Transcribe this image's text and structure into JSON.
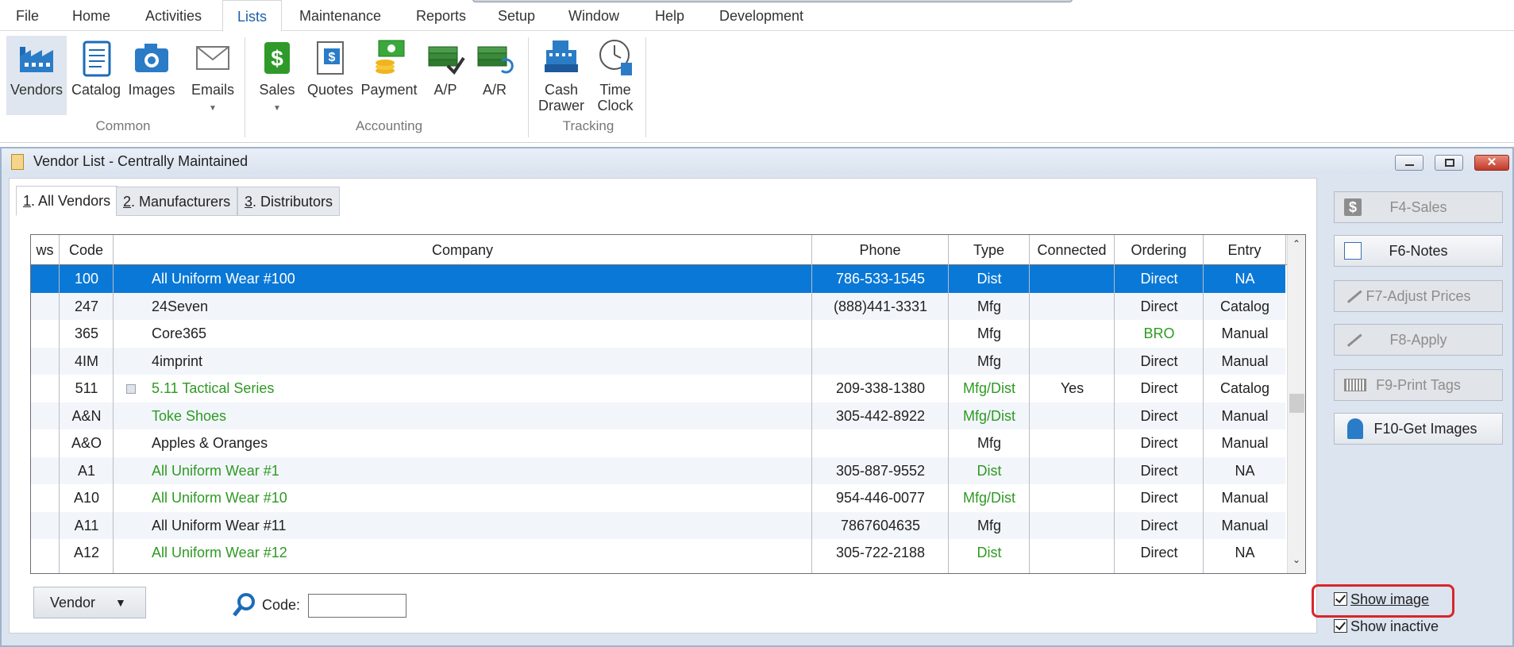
{
  "menu": {
    "items": [
      "File",
      "Home",
      "Activities",
      "Lists",
      "Maintenance",
      "Reports",
      "Setup",
      "Window",
      "Help",
      "Development"
    ],
    "active": "Lists"
  },
  "ribbon": {
    "groups": {
      "common": "Common",
      "accounting": "Accounting",
      "tracking": "Tracking"
    },
    "buttons": {
      "vendors": "Vendors",
      "catalog": "Catalog",
      "images": "Images",
      "emails": "Emails",
      "sales": "Sales",
      "quotes": "Quotes",
      "payment": "Payment",
      "ap": "A/P",
      "ar": "A/R",
      "cash_drawer_1": "Cash",
      "cash_drawer_2": "Drawer",
      "time_clock_1": "Time",
      "time_clock_2": "Clock"
    }
  },
  "window": {
    "title": "Vendor List - Centrally Maintained"
  },
  "tabs": [
    {
      "key": "1",
      "label": ". All Vendors"
    },
    {
      "key": "2",
      "label": ". Manufacturers"
    },
    {
      "key": "3",
      "label": ". Distributors"
    }
  ],
  "grid": {
    "columns": [
      "ws",
      "Code",
      "Company",
      "Phone",
      "Type",
      "Connected",
      "Ordering",
      "Entry"
    ],
    "rows": [
      {
        "code": "100",
        "company": "All Uniform Wear #100",
        "phone": "786-533-1545",
        "type": "Dist",
        "connected": "",
        "ordering": "Direct",
        "entry": "NA",
        "company_green": false,
        "type_green": false,
        "ordering_green": false,
        "note": false
      },
      {
        "code": "247",
        "company": "24Seven",
        "phone": "(888)441-3331",
        "type": "Mfg",
        "connected": "",
        "ordering": "Direct",
        "entry": "Catalog",
        "company_green": false,
        "type_green": false,
        "ordering_green": false,
        "note": false
      },
      {
        "code": "365",
        "company": "Core365",
        "phone": "",
        "type": "Mfg",
        "connected": "",
        "ordering": "BRO",
        "entry": "Manual",
        "company_green": false,
        "type_green": false,
        "ordering_green": true,
        "note": false
      },
      {
        "code": "4IM",
        "company": "4imprint",
        "phone": "",
        "type": "Mfg",
        "connected": "",
        "ordering": "Direct",
        "entry": "Manual",
        "company_green": false,
        "type_green": false,
        "ordering_green": false,
        "note": false
      },
      {
        "code": "511",
        "company": "5.11 Tactical Series",
        "phone": "209-338-1380",
        "type": "Mfg/Dist",
        "connected": "Yes",
        "ordering": "Direct",
        "entry": "Catalog",
        "company_green": true,
        "type_green": true,
        "ordering_green": false,
        "note": true
      },
      {
        "code": "A&N",
        "company": "Toke Shoes",
        "phone": "305-442-8922",
        "type": "Mfg/Dist",
        "connected": "",
        "ordering": "Direct",
        "entry": "Manual",
        "company_green": true,
        "type_green": true,
        "ordering_green": false,
        "note": false
      },
      {
        "code": "A&O",
        "company": "Apples & Oranges",
        "phone": "",
        "type": "Mfg",
        "connected": "",
        "ordering": "Direct",
        "entry": "Manual",
        "company_green": false,
        "type_green": false,
        "ordering_green": false,
        "note": false
      },
      {
        "code": "A1",
        "company": "All Uniform Wear #1",
        "phone": "305-887-9552",
        "type": "Dist",
        "connected": "",
        "ordering": "Direct",
        "entry": "NA",
        "company_green": true,
        "type_green": true,
        "ordering_green": false,
        "note": false
      },
      {
        "code": "A10",
        "company": "All Uniform Wear #10",
        "phone": "954-446-0077",
        "type": "Mfg/Dist",
        "connected": "",
        "ordering": "Direct",
        "entry": "Manual",
        "company_green": true,
        "type_green": true,
        "ordering_green": false,
        "note": false
      },
      {
        "code": "A11",
        "company": "All Uniform Wear #11",
        "phone": "7867604635",
        "type": "Mfg",
        "connected": "",
        "ordering": "Direct",
        "entry": "Manual",
        "company_green": false,
        "type_green": false,
        "ordering_green": false,
        "note": false
      },
      {
        "code": "A12",
        "company": "All Uniform Wear #12",
        "phone": "305-722-2188",
        "type": "Dist",
        "connected": "",
        "ordering": "Direct",
        "entry": "NA",
        "company_green": true,
        "type_green": true,
        "ordering_green": false,
        "note": false
      }
    ]
  },
  "bottom": {
    "vendor_button": "Vendor",
    "code_label": "Code:",
    "code_value": ""
  },
  "side": {
    "f4": "F4-Sales",
    "f6": "F6-Notes",
    "f7": "F7-Adjust Prices",
    "f8": "F8-Apply",
    "f9": "F9-Print Tags",
    "f10": "F10-Get Images",
    "show_image": "Show image",
    "show_inactive": "Show inactive"
  },
  "colors": {
    "selection": "#0a78d7",
    "green_text": "#2e9a22",
    "highlight_ring": "#d9262b"
  }
}
